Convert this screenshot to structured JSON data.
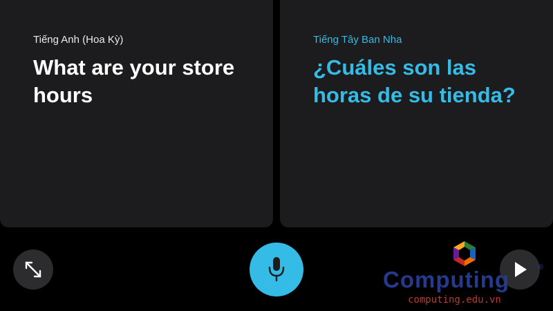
{
  "source_panel": {
    "language": "Tiếng Anh (Hoa Kỳ)",
    "text": "What are your store hours"
  },
  "target_panel": {
    "language": "Tiếng Tây Ban Nha",
    "text": "¿Cuáles son las horas de su tienda?"
  },
  "controls": {
    "expand_icon": "expand-arrows-icon",
    "mic_icon": "microphone-icon",
    "play_icon": "play-icon"
  },
  "colors": {
    "accent": "#35bce6",
    "card_background": "#1c1c1e",
    "button_background": "#2c2c2e",
    "page_background": "#000000"
  },
  "watermark": {
    "name": "Computing",
    "registered": "®",
    "url": "computing.edu.vn"
  }
}
